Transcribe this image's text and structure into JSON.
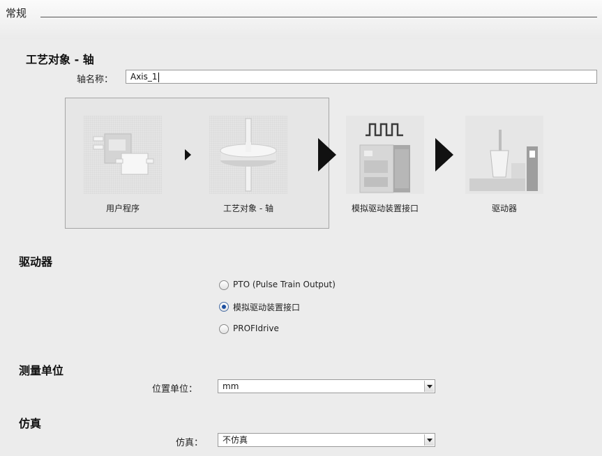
{
  "header": {
    "title": "常规"
  },
  "tech_object": {
    "title": "工艺对象 - 轴",
    "axis_name_label": "轴名称：",
    "axis_name_value": "Axis_1"
  },
  "flow": {
    "items": [
      {
        "label": "用户程序",
        "icon": "user-program-blocks-icon"
      },
      {
        "label": "工艺对象 - 轴",
        "icon": "axis-disc-icon"
      },
      {
        "label": "模拟驱动装置接口",
        "icon": "analog-drive-interface-icon"
      },
      {
        "label": "驱动器",
        "icon": "drive-motor-icon"
      }
    ]
  },
  "drive": {
    "title": "驱动器",
    "options": [
      {
        "label": "PTO (Pulse Train Output)",
        "checked": false
      },
      {
        "label": "模拟驱动装置接口",
        "checked": true
      },
      {
        "label": "PROFIdrive",
        "checked": false
      }
    ]
  },
  "units": {
    "title": "测量单位",
    "position_unit_label": "位置单位：",
    "position_unit_value": "mm"
  },
  "simulation": {
    "title": "仿真",
    "label": "仿真：",
    "value": "不仿真"
  }
}
